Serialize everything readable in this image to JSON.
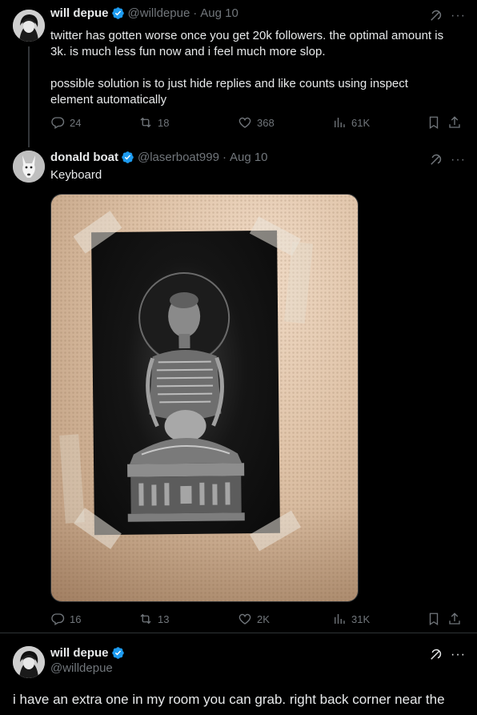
{
  "tweet1": {
    "name": "will depue",
    "handle": "@willdepue",
    "date": "Aug 10",
    "text_lines": [
      "twitter has gotten worse once you get 20k followers. the optimal amount is",
      "3k. is much less fun now and i feel much more slop."
    ],
    "text_lines_2": [
      "possible solution is to just hide replies and like counts using inspect",
      "element automatically"
    ],
    "stats": {
      "replies": "24",
      "reposts": "18",
      "likes": "368",
      "views": "61K"
    }
  },
  "tweet2": {
    "name": "donald boat",
    "handle": "@laserboat999",
    "date": "Aug 10",
    "text": "Keyboard",
    "stats": {
      "replies": "16",
      "reposts": "13",
      "likes": "2K",
      "views": "31K"
    }
  },
  "tweet3": {
    "name": "will depue",
    "handle": "@willdepue",
    "text": "i have an extra one in my room you can grab. right back corner near the"
  },
  "ui": {
    "sep": "·",
    "more": "···"
  },
  "colors": {
    "background": "#000000",
    "text": "#e7e9ea",
    "muted": "#71767b",
    "verified": "#1d9bf0",
    "thread_line": "#333639"
  },
  "icons": [
    "verified-badge-icon",
    "grok-icon",
    "more-icon",
    "reply-icon",
    "repost-icon",
    "like-icon",
    "views-icon",
    "bookmark-icon",
    "share-icon"
  ]
}
